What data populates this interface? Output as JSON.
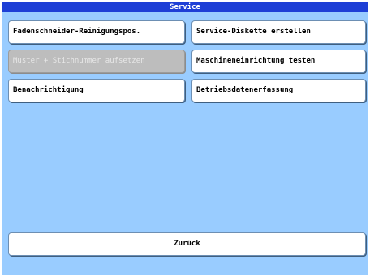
{
  "window": {
    "title": "Service"
  },
  "buttons": {
    "thread_cutter_cleaning": "Fadenschneider-Reinigungspos.",
    "create_service_disk": "Service-Diskette erstellen",
    "set_pattern_stitch": "Muster + Stichnummer aufsetzen",
    "test_machine_setup": "Maschineneinrichtung testen",
    "notification": "Benachrichtigung",
    "operating_data_capture": "Betriebsdatenerfassung",
    "back": "Zurück"
  },
  "colors": {
    "titlebar": "#1e3fd6",
    "panel": "#99ccff",
    "button": "#ffffff",
    "button_disabled": "#bdbdbd"
  }
}
